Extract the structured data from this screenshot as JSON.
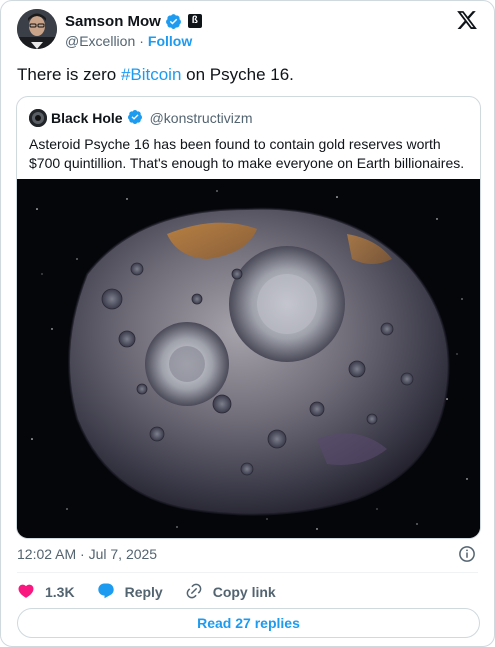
{
  "author": {
    "display_name": "Samson Mow",
    "handle": "@Excellion",
    "separator": "·",
    "follow_label": "Follow",
    "affiliate_badge": "ß"
  },
  "tweet": {
    "text_before": "There is zero ",
    "hashtag": "#Bitcoin",
    "text_after": " on Psyche 16."
  },
  "quoted": {
    "display_name": "Black Hole",
    "handle": "@konstructivizm",
    "text": "Asteroid Psyche 16 has been found to contain gold reserves worth $700 quintillion. That's enough to make everyone on Earth billionaires."
  },
  "meta": {
    "timestamp": "12:02 AM · Jul 7, 2025"
  },
  "actions": {
    "like_count": "1.3K",
    "reply_label": "Reply",
    "copy_link_label": "Copy link"
  },
  "read_replies_label": "Read 27 replies",
  "colors": {
    "accent": "#1d9bf0",
    "like": "#f91880",
    "text": "#0f1419",
    "muted": "#536471"
  },
  "icons": [
    "verified-icon",
    "x-logo-icon",
    "info-icon",
    "heart-icon",
    "reply-icon",
    "link-icon"
  ]
}
